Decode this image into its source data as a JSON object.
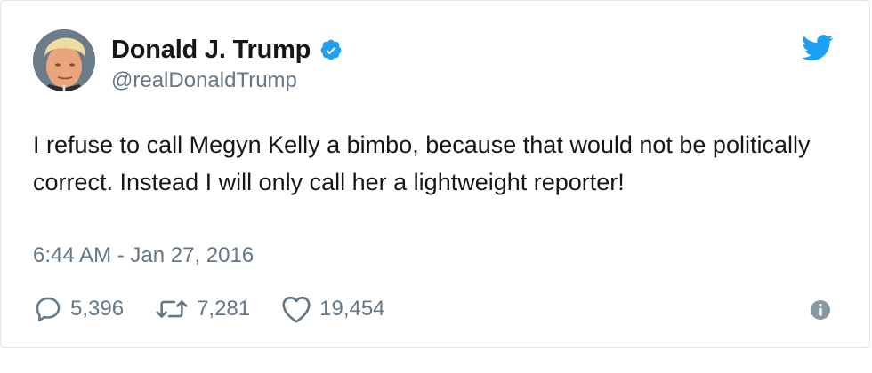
{
  "author": {
    "display_name": "Donald J. Trump",
    "handle": "@realDonaldTrump",
    "verified": true,
    "avatar_icon": "profile-photo"
  },
  "tweet": {
    "text": "I refuse to call Megyn Kelly a bimbo, because that would not be politically correct. Instead I will only call her a lightweight reporter!",
    "timestamp": "6:44 AM - Jan 27, 2016"
  },
  "actions": {
    "replies": "5,396",
    "retweets": "7,281",
    "likes": "19,454"
  },
  "icons": {
    "brand": "twitter-bird-icon",
    "verified": "verified-badge-icon",
    "reply": "reply-icon",
    "retweet": "retweet-icon",
    "like": "heart-icon",
    "info": "info-icon"
  },
  "colors": {
    "brand_blue": "#1da1f2",
    "text_primary": "#14171a",
    "text_secondary": "#657786",
    "border": "#e1e8ed"
  }
}
